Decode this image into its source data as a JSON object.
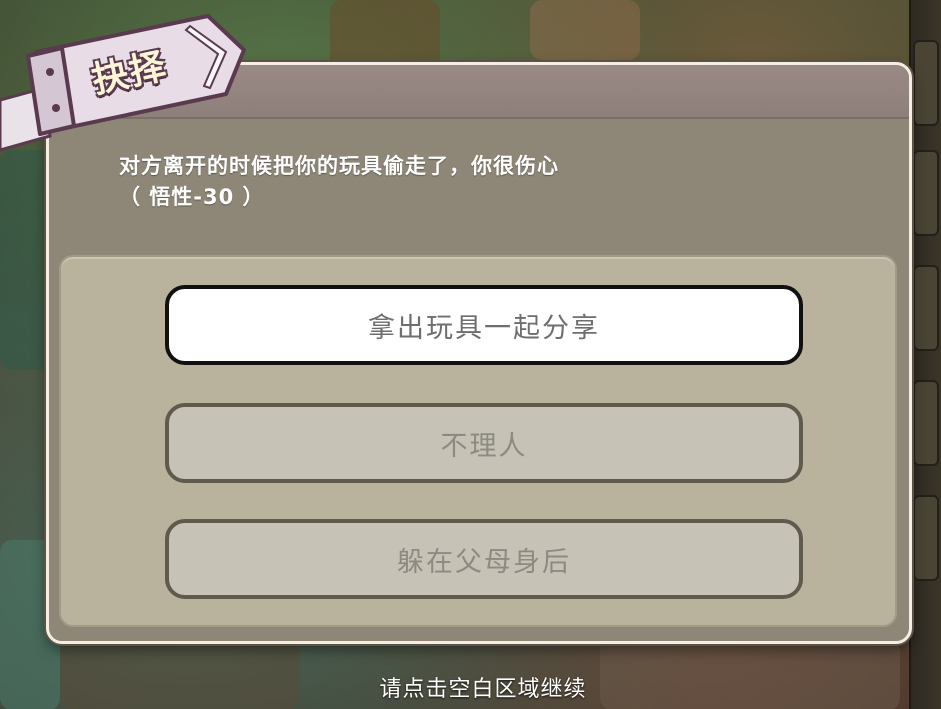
{
  "dialog": {
    "title": "抉择",
    "prompt": "对方离开的时候把你的玩具偷走了，你很伤心",
    "effect": "（  悟性-30 ）",
    "options": [
      {
        "label": "拿出玩具一起分享",
        "state": "highlighted"
      },
      {
        "label": "不理人",
        "state": "normal"
      },
      {
        "label": "躲在父母身后",
        "state": "normal"
      }
    ]
  },
  "hint": "请点击空白区域继续",
  "colors": {
    "panel": "#8e8778",
    "options_box": "#b9b29d",
    "highlight_bg": "#ffffff",
    "option_bg": "#c6c2b6",
    "banner": "#e8dde6",
    "banner_outline": "#5a3a4e"
  }
}
